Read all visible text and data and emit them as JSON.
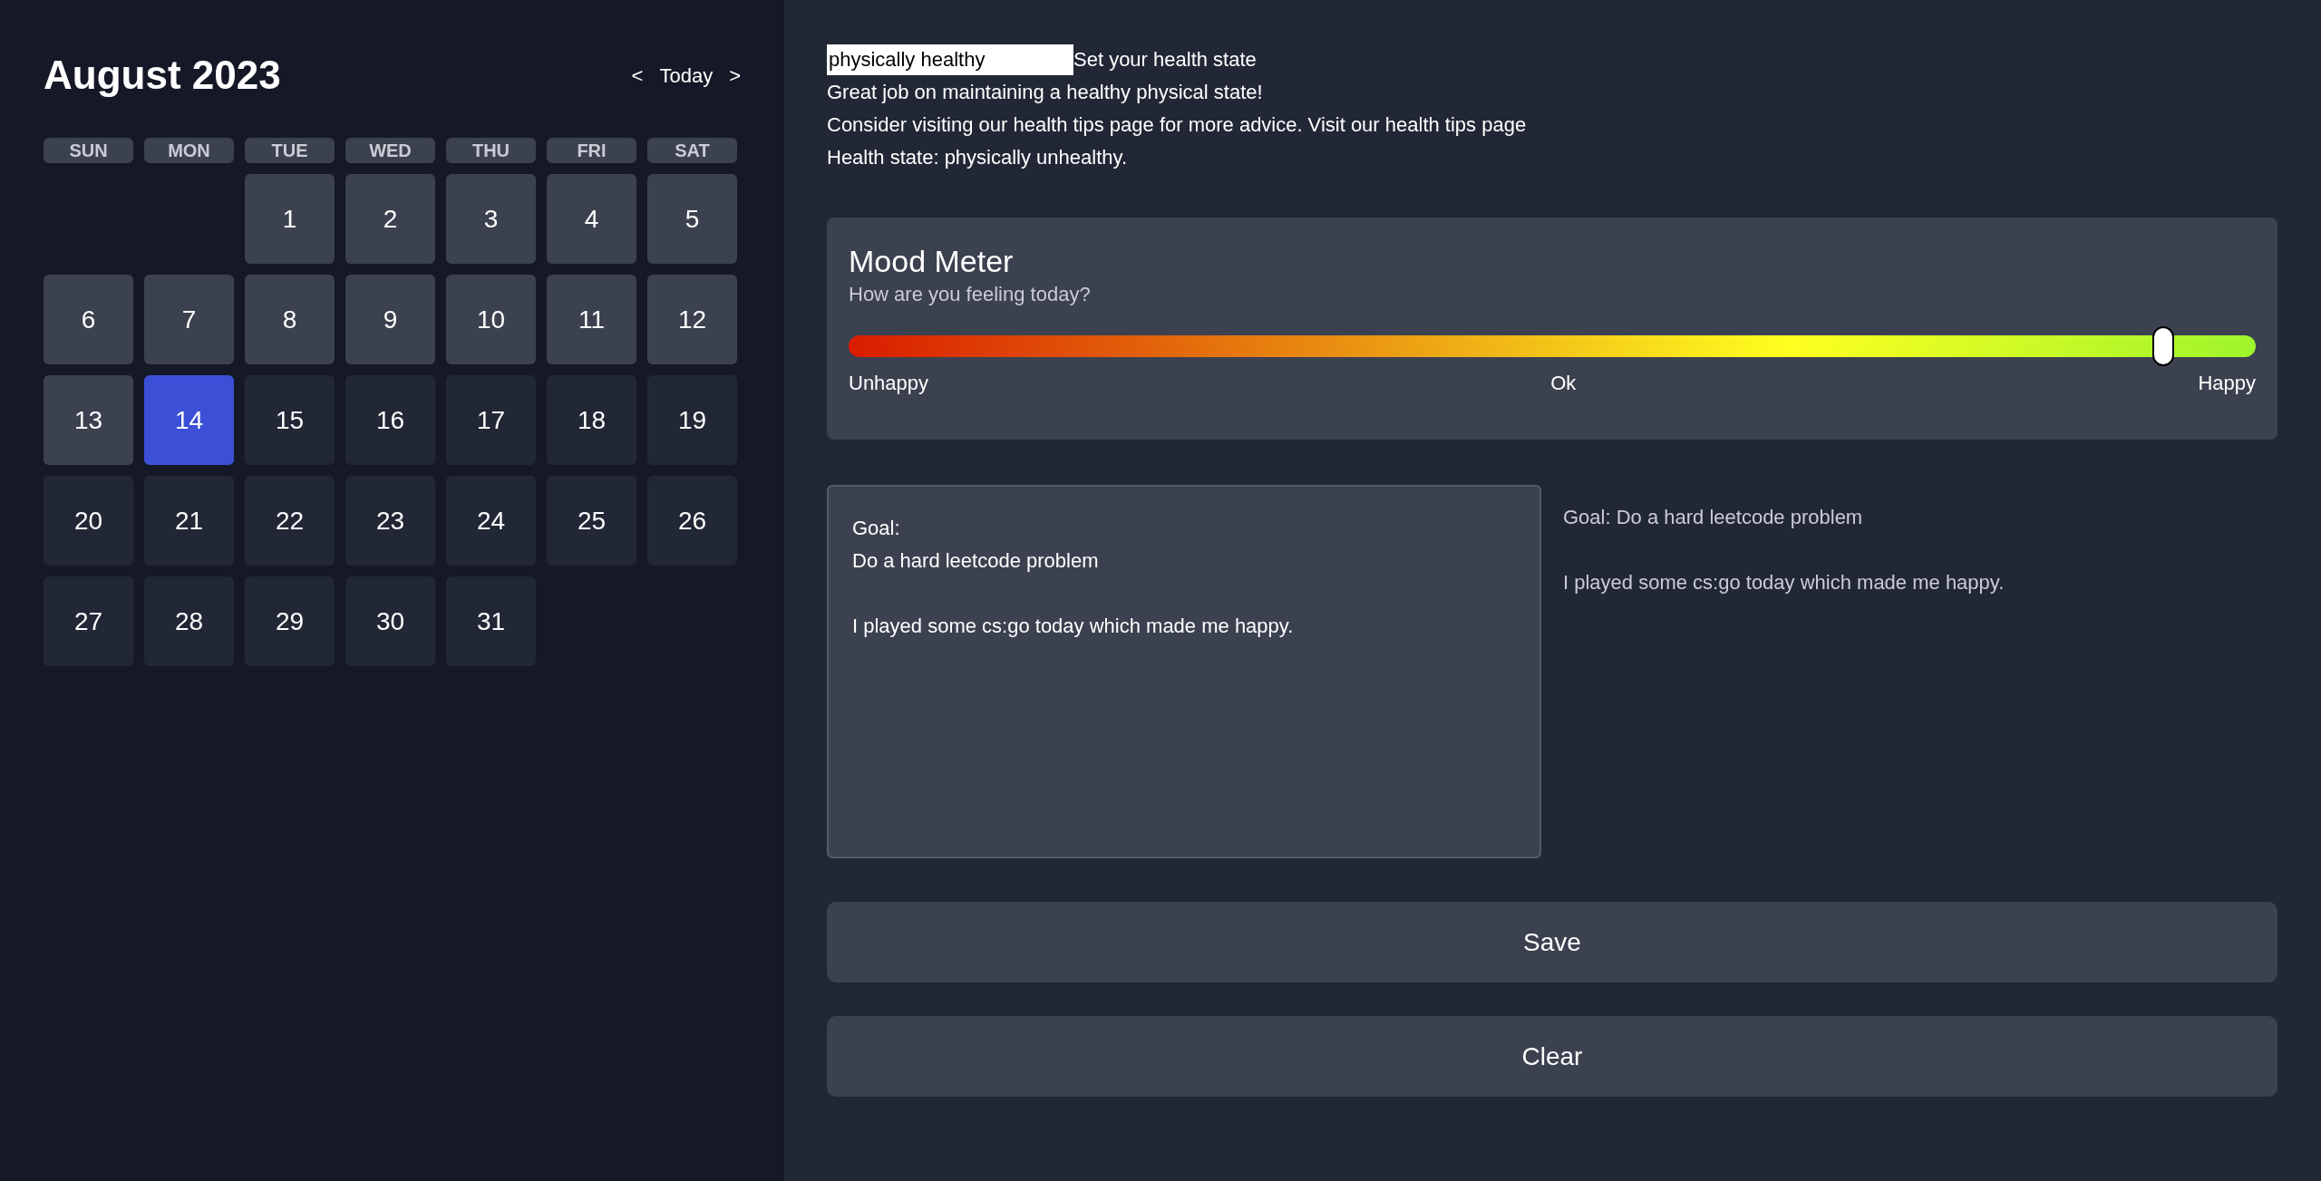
{
  "calendar": {
    "title": "August 2023",
    "prev": "<",
    "today": "Today",
    "next": ">",
    "weekdays": [
      "SUN",
      "MON",
      "TUE",
      "WED",
      "THU",
      "FRI",
      "SAT"
    ],
    "days": [
      {
        "kind": "blank"
      },
      {
        "kind": "blank"
      },
      {
        "kind": "day",
        "label": "1",
        "past": true,
        "selected": false
      },
      {
        "kind": "day",
        "label": "2",
        "past": true,
        "selected": false
      },
      {
        "kind": "day",
        "label": "3",
        "past": true,
        "selected": false
      },
      {
        "kind": "day",
        "label": "4",
        "past": true,
        "selected": false
      },
      {
        "kind": "day",
        "label": "5",
        "past": true,
        "selected": false
      },
      {
        "kind": "day",
        "label": "6",
        "past": true,
        "selected": false
      },
      {
        "kind": "day",
        "label": "7",
        "past": true,
        "selected": false
      },
      {
        "kind": "day",
        "label": "8",
        "past": true,
        "selected": false
      },
      {
        "kind": "day",
        "label": "9",
        "past": true,
        "selected": false
      },
      {
        "kind": "day",
        "label": "10",
        "past": true,
        "selected": false
      },
      {
        "kind": "day",
        "label": "11",
        "past": true,
        "selected": false
      },
      {
        "kind": "day",
        "label": "12",
        "past": true,
        "selected": false
      },
      {
        "kind": "day",
        "label": "13",
        "past": true,
        "selected": false
      },
      {
        "kind": "day",
        "label": "14",
        "past": false,
        "selected": true
      },
      {
        "kind": "day",
        "label": "15",
        "past": false,
        "selected": false
      },
      {
        "kind": "day",
        "label": "16",
        "past": false,
        "selected": false
      },
      {
        "kind": "day",
        "label": "17",
        "past": false,
        "selected": false
      },
      {
        "kind": "day",
        "label": "18",
        "past": false,
        "selected": false
      },
      {
        "kind": "day",
        "label": "19",
        "past": false,
        "selected": false
      },
      {
        "kind": "day",
        "label": "20",
        "past": false,
        "selected": false
      },
      {
        "kind": "day",
        "label": "21",
        "past": false,
        "selected": false
      },
      {
        "kind": "day",
        "label": "22",
        "past": false,
        "selected": false
      },
      {
        "kind": "day",
        "label": "23",
        "past": false,
        "selected": false
      },
      {
        "kind": "day",
        "label": "24",
        "past": false,
        "selected": false
      },
      {
        "kind": "day",
        "label": "25",
        "past": false,
        "selected": false
      },
      {
        "kind": "day",
        "label": "26",
        "past": false,
        "selected": false
      },
      {
        "kind": "day",
        "label": "27",
        "past": false,
        "selected": false
      },
      {
        "kind": "day",
        "label": "28",
        "past": false,
        "selected": false
      },
      {
        "kind": "day",
        "label": "29",
        "past": false,
        "selected": false
      },
      {
        "kind": "day",
        "label": "30",
        "past": false,
        "selected": false
      },
      {
        "kind": "day",
        "label": "31",
        "past": false,
        "selected": false
      }
    ]
  },
  "health": {
    "input_value": "physically healthy",
    "input_label": "Set your health state",
    "message": "Great job on maintaining a healthy physical state!",
    "advice": "Consider visiting our health tips page for more advice.",
    "advice_link": "Visit our health tips page",
    "state": "Health state: physically unhealthy."
  },
  "mood_meter": {
    "title": "Mood Meter",
    "subtitle": "How are you feeling today?",
    "level": 0.934,
    "labels": [
      "Unhappy",
      "Ok",
      "Happy"
    ]
  },
  "journal": {
    "value": "Goal:\nDo a hard leetcode problem\n\nI played some cs:go today which made me happy.",
    "preview": [
      "Goal: Do a hard leetcode problem",
      "I played some cs:go today which made me happy."
    ]
  },
  "buttons": [
    "Save",
    "Clear"
  ]
}
